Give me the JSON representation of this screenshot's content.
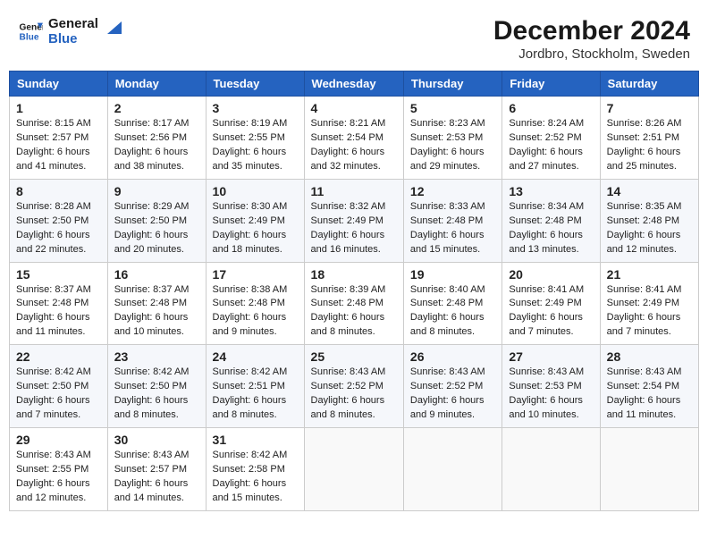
{
  "header": {
    "logo_line1": "General",
    "logo_line2": "Blue",
    "month": "December 2024",
    "location": "Jordbro, Stockholm, Sweden"
  },
  "weekdays": [
    "Sunday",
    "Monday",
    "Tuesday",
    "Wednesday",
    "Thursday",
    "Friday",
    "Saturday"
  ],
  "weeks": [
    [
      {
        "day": "1",
        "sunrise": "8:15 AM",
        "sunset": "2:57 PM",
        "daylight": "6 hours and 41 minutes."
      },
      {
        "day": "2",
        "sunrise": "8:17 AM",
        "sunset": "2:56 PM",
        "daylight": "6 hours and 38 minutes."
      },
      {
        "day": "3",
        "sunrise": "8:19 AM",
        "sunset": "2:55 PM",
        "daylight": "6 hours and 35 minutes."
      },
      {
        "day": "4",
        "sunrise": "8:21 AM",
        "sunset": "2:54 PM",
        "daylight": "6 hours and 32 minutes."
      },
      {
        "day": "5",
        "sunrise": "8:23 AM",
        "sunset": "2:53 PM",
        "daylight": "6 hours and 29 minutes."
      },
      {
        "day": "6",
        "sunrise": "8:24 AM",
        "sunset": "2:52 PM",
        "daylight": "6 hours and 27 minutes."
      },
      {
        "day": "7",
        "sunrise": "8:26 AM",
        "sunset": "2:51 PM",
        "daylight": "6 hours and 25 minutes."
      }
    ],
    [
      {
        "day": "8",
        "sunrise": "8:28 AM",
        "sunset": "2:50 PM",
        "daylight": "6 hours and 22 minutes."
      },
      {
        "day": "9",
        "sunrise": "8:29 AM",
        "sunset": "2:50 PM",
        "daylight": "6 hours and 20 minutes."
      },
      {
        "day": "10",
        "sunrise": "8:30 AM",
        "sunset": "2:49 PM",
        "daylight": "6 hours and 18 minutes."
      },
      {
        "day": "11",
        "sunrise": "8:32 AM",
        "sunset": "2:49 PM",
        "daylight": "6 hours and 16 minutes."
      },
      {
        "day": "12",
        "sunrise": "8:33 AM",
        "sunset": "2:48 PM",
        "daylight": "6 hours and 15 minutes."
      },
      {
        "day": "13",
        "sunrise": "8:34 AM",
        "sunset": "2:48 PM",
        "daylight": "6 hours and 13 minutes."
      },
      {
        "day": "14",
        "sunrise": "8:35 AM",
        "sunset": "2:48 PM",
        "daylight": "6 hours and 12 minutes."
      }
    ],
    [
      {
        "day": "15",
        "sunrise": "8:37 AM",
        "sunset": "2:48 PM",
        "daylight": "6 hours and 11 minutes."
      },
      {
        "day": "16",
        "sunrise": "8:37 AM",
        "sunset": "2:48 PM",
        "daylight": "6 hours and 10 minutes."
      },
      {
        "day": "17",
        "sunrise": "8:38 AM",
        "sunset": "2:48 PM",
        "daylight": "6 hours and 9 minutes."
      },
      {
        "day": "18",
        "sunrise": "8:39 AM",
        "sunset": "2:48 PM",
        "daylight": "6 hours and 8 minutes."
      },
      {
        "day": "19",
        "sunrise": "8:40 AM",
        "sunset": "2:48 PM",
        "daylight": "6 hours and 8 minutes."
      },
      {
        "day": "20",
        "sunrise": "8:41 AM",
        "sunset": "2:49 PM",
        "daylight": "6 hours and 7 minutes."
      },
      {
        "day": "21",
        "sunrise": "8:41 AM",
        "sunset": "2:49 PM",
        "daylight": "6 hours and 7 minutes."
      }
    ],
    [
      {
        "day": "22",
        "sunrise": "8:42 AM",
        "sunset": "2:50 PM",
        "daylight": "6 hours and 7 minutes."
      },
      {
        "day": "23",
        "sunrise": "8:42 AM",
        "sunset": "2:50 PM",
        "daylight": "6 hours and 8 minutes."
      },
      {
        "day": "24",
        "sunrise": "8:42 AM",
        "sunset": "2:51 PM",
        "daylight": "6 hours and 8 minutes."
      },
      {
        "day": "25",
        "sunrise": "8:43 AM",
        "sunset": "2:52 PM",
        "daylight": "6 hours and 8 minutes."
      },
      {
        "day": "26",
        "sunrise": "8:43 AM",
        "sunset": "2:52 PM",
        "daylight": "6 hours and 9 minutes."
      },
      {
        "day": "27",
        "sunrise": "8:43 AM",
        "sunset": "2:53 PM",
        "daylight": "6 hours and 10 minutes."
      },
      {
        "day": "28",
        "sunrise": "8:43 AM",
        "sunset": "2:54 PM",
        "daylight": "6 hours and 11 minutes."
      }
    ],
    [
      {
        "day": "29",
        "sunrise": "8:43 AM",
        "sunset": "2:55 PM",
        "daylight": "6 hours and 12 minutes."
      },
      {
        "day": "30",
        "sunrise": "8:43 AM",
        "sunset": "2:57 PM",
        "daylight": "6 hours and 14 minutes."
      },
      {
        "day": "31",
        "sunrise": "8:42 AM",
        "sunset": "2:58 PM",
        "daylight": "6 hours and 15 minutes."
      },
      null,
      null,
      null,
      null
    ]
  ],
  "labels": {
    "sunrise": "Sunrise:",
    "sunset": "Sunset:",
    "daylight": "Daylight:"
  }
}
